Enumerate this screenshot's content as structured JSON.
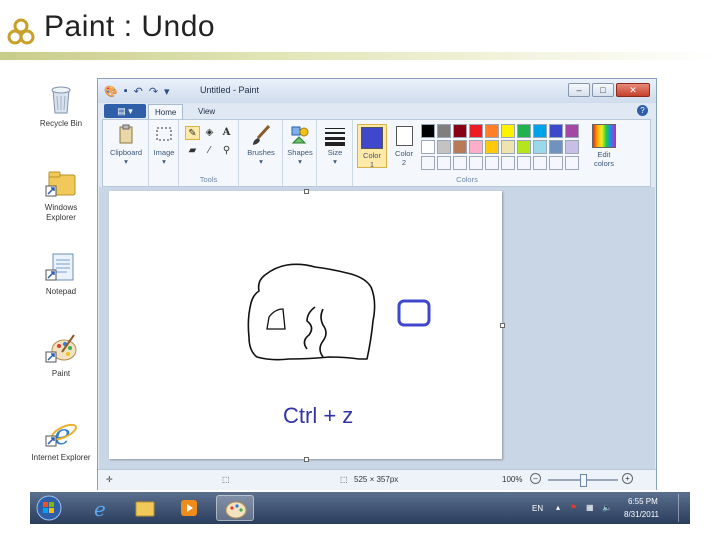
{
  "slide": {
    "title": "Paint : Undo"
  },
  "desktop": {
    "icons": [
      {
        "name": "recycle-bin",
        "label": "Recycle Bin"
      },
      {
        "name": "windows-explorer",
        "label": "Windows Explorer"
      },
      {
        "name": "notepad",
        "label": "Notepad"
      },
      {
        "name": "paint",
        "label": "Paint"
      },
      {
        "name": "internet-explorer",
        "label": "Internet Explorer"
      }
    ]
  },
  "window": {
    "title": "Untitled - Paint",
    "tabs": {
      "home": "Home",
      "view": "View"
    },
    "ribbon": {
      "clipboard": "Clipboard",
      "image": "Image",
      "tools": "Tools",
      "brushes": "Brushes",
      "shapes": "Shapes",
      "size": "Size",
      "color1": "Color 1",
      "color2": "Color 2",
      "colors": "Colors",
      "edit_colors": "Edit colors"
    },
    "palette_row1": [
      "#000000",
      "#7f7f7f",
      "#880015",
      "#ed1c24",
      "#ff7f27",
      "#fff200",
      "#22b14c",
      "#00a2e8",
      "#3f48cc",
      "#a349a4"
    ],
    "palette_row2": [
      "#ffffff",
      "#c3c3c3",
      "#b97a57",
      "#ffaec9",
      "#ffc90e",
      "#efe4b0",
      "#b5e61d",
      "#99d9ea",
      "#7092be",
      "#c8bfe7"
    ],
    "color1": "#3f48cc",
    "color2": "#ffffff",
    "canvas_caption": "Ctrl + z",
    "status": {
      "dimensions": "525 × 357px",
      "zoom": "100%"
    }
  },
  "taskbar": {
    "language": "EN",
    "time": "6:55 PM",
    "date": "8/31/2011"
  }
}
